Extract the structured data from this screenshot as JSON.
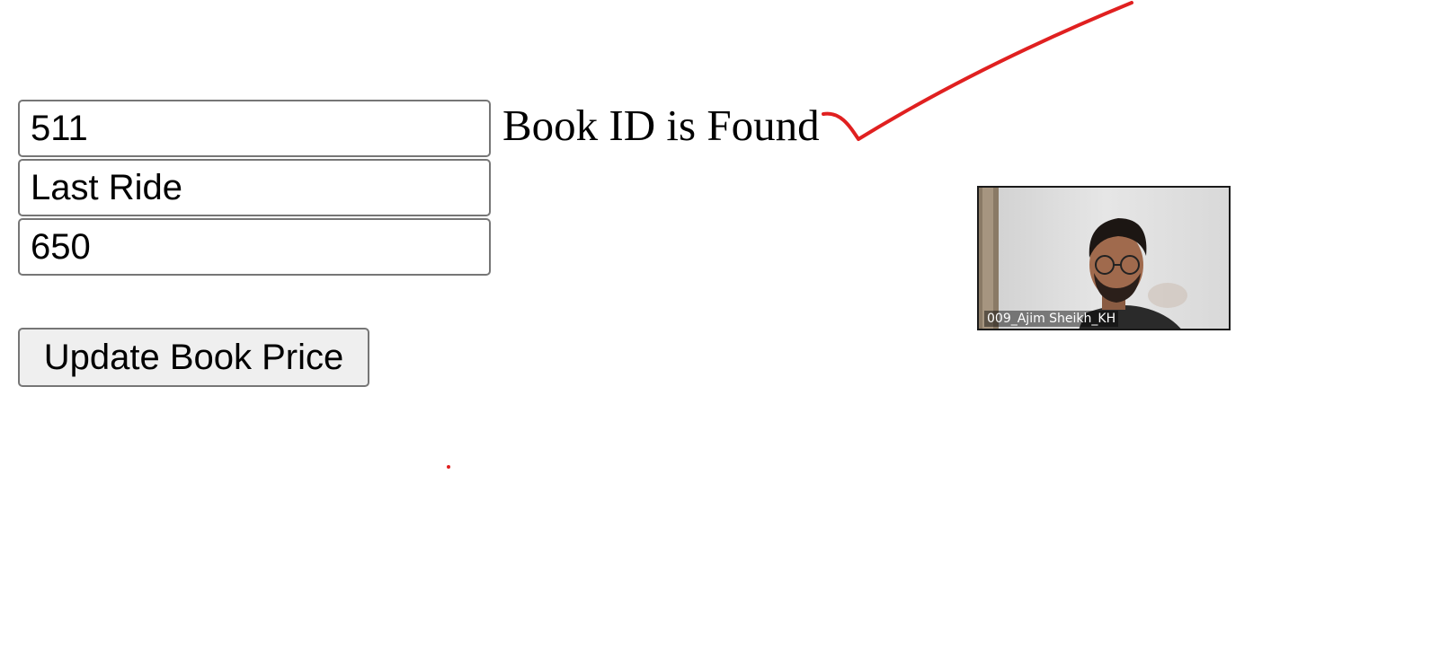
{
  "form": {
    "book_id_value": "511",
    "book_name_value": "Last Ride",
    "book_price_value": "650",
    "status_text": "Book ID is Found",
    "update_button_label": "Update Book Price"
  },
  "annotation": {
    "stroke_color": "#e02020",
    "shape": "checkmark"
  },
  "video_tile": {
    "participant_name": "009_Ajim Sheikh_KH"
  }
}
